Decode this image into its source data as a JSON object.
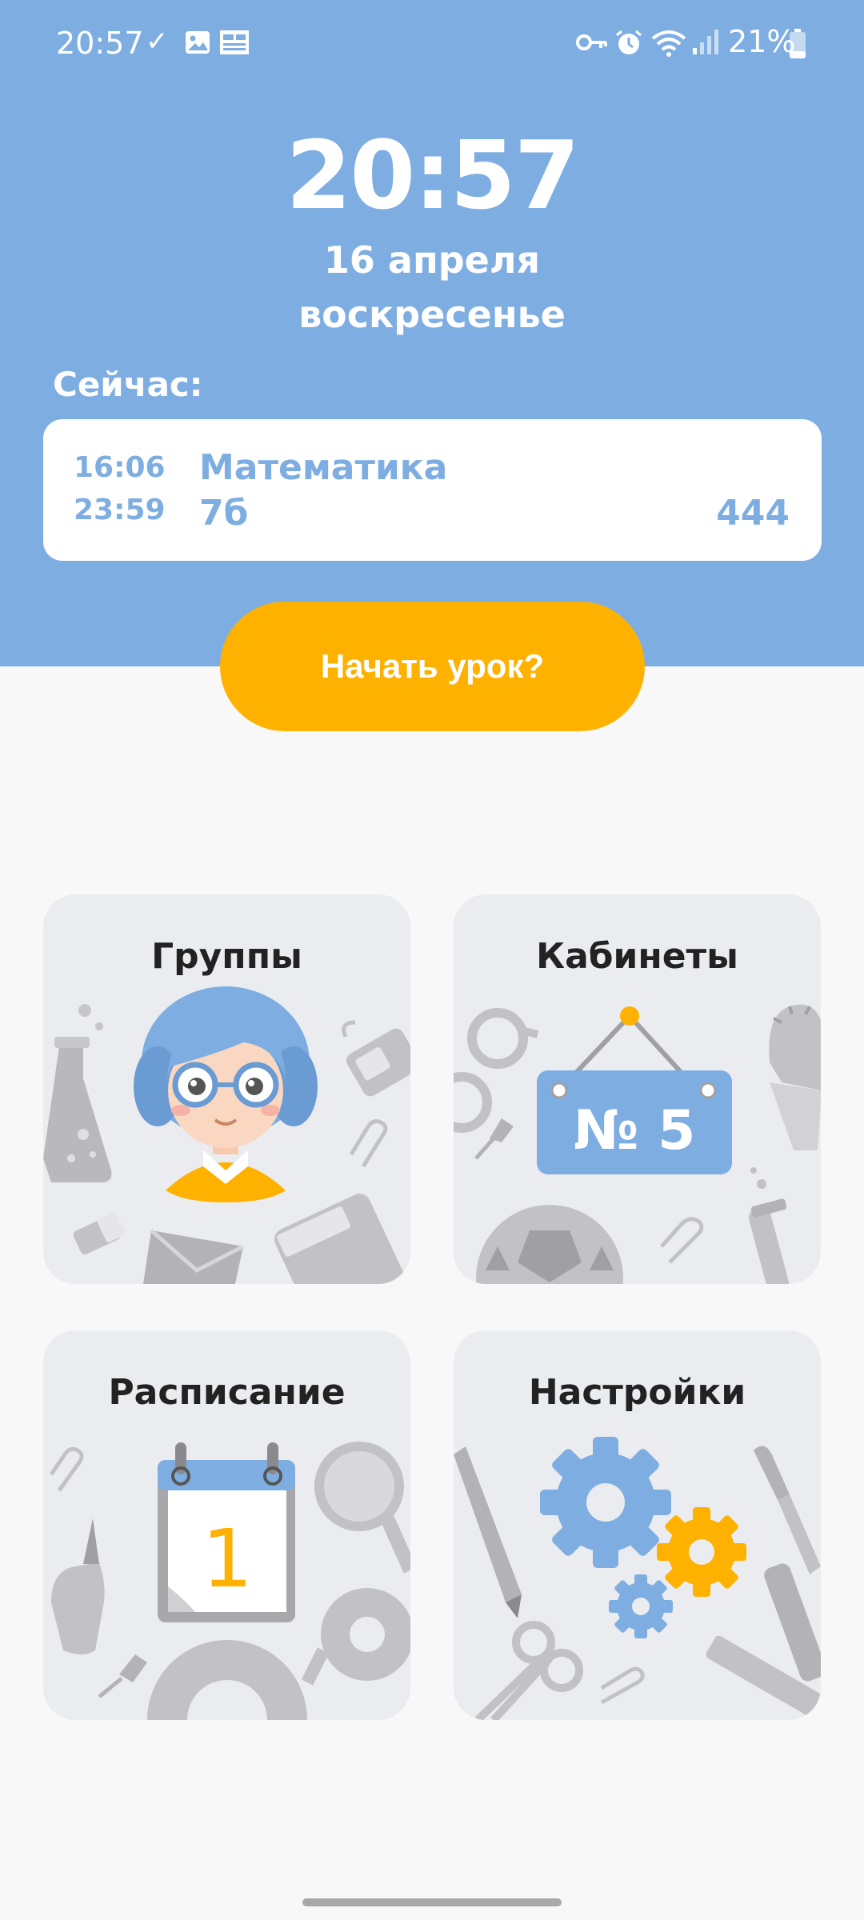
{
  "status_bar": {
    "time": "20:57",
    "check_icon": "✓",
    "battery_percent": "21%",
    "icons": [
      "check-icon",
      "image-icon",
      "news-icon",
      "vpn-key-icon",
      "alarm-icon",
      "wifi-icon",
      "signal-icon",
      "battery-icon"
    ]
  },
  "clock": {
    "time": "20:57",
    "date": "16 апреля",
    "weekday": "воскресенье"
  },
  "current": {
    "label": "Сейчас:",
    "start": "16:06",
    "end": "23:59",
    "subject": "Математика",
    "group": "7б",
    "room": "444"
  },
  "start_button": {
    "label": "Начать урок?"
  },
  "tiles": [
    {
      "title": "Группы"
    },
    {
      "title": "Кабинеты",
      "sign_text": "№ 5"
    },
    {
      "title": "Расписание",
      "calendar_day": "1"
    },
    {
      "title": "Настройки"
    }
  ],
  "colors": {
    "header": "#7eaee1",
    "accent": "#ffb100",
    "tile_bg": "#eaecef",
    "background": "#f8f8f8"
  }
}
